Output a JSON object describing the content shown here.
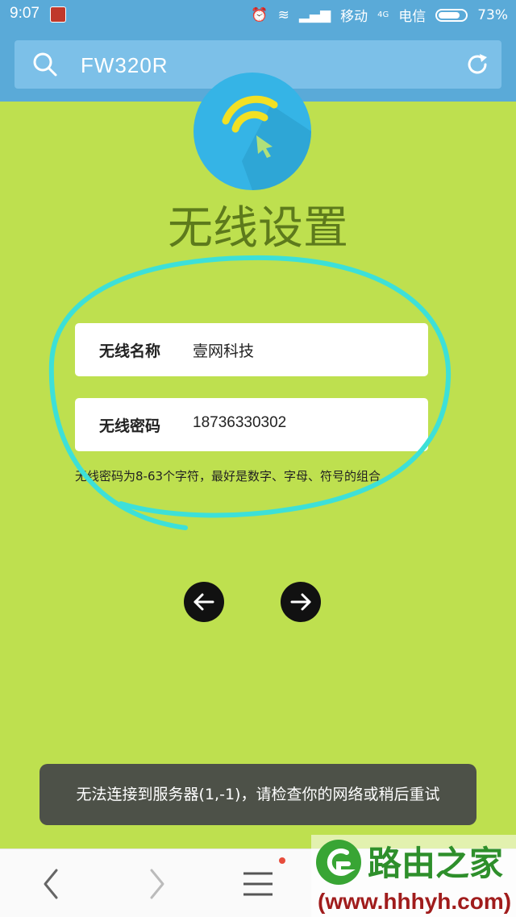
{
  "status_bar": {
    "time": "9:07",
    "carrier1": "移动",
    "net_type": "4G",
    "carrier2": "电信",
    "battery": "73%"
  },
  "search": {
    "query": "FW320R"
  },
  "page": {
    "title": "无线设置",
    "fields": [
      {
        "label": "无线名称",
        "value": "壹网科技"
      },
      {
        "label": "无线密码",
        "value": "18736330302"
      }
    ],
    "hint": "无线密码为8-63个字符，最好是数字、字母、符号的组合"
  },
  "toast": "无法连接到服务器(1,-1)，请检查你的网络或稍后重试",
  "watermark": {
    "name": "路由之家",
    "url": "(www.hhhyh.com)"
  },
  "colors": {
    "background": "#bee04f",
    "header": "#5aaad8",
    "title": "#5d7a1c",
    "annotation": "#3de0d8"
  }
}
